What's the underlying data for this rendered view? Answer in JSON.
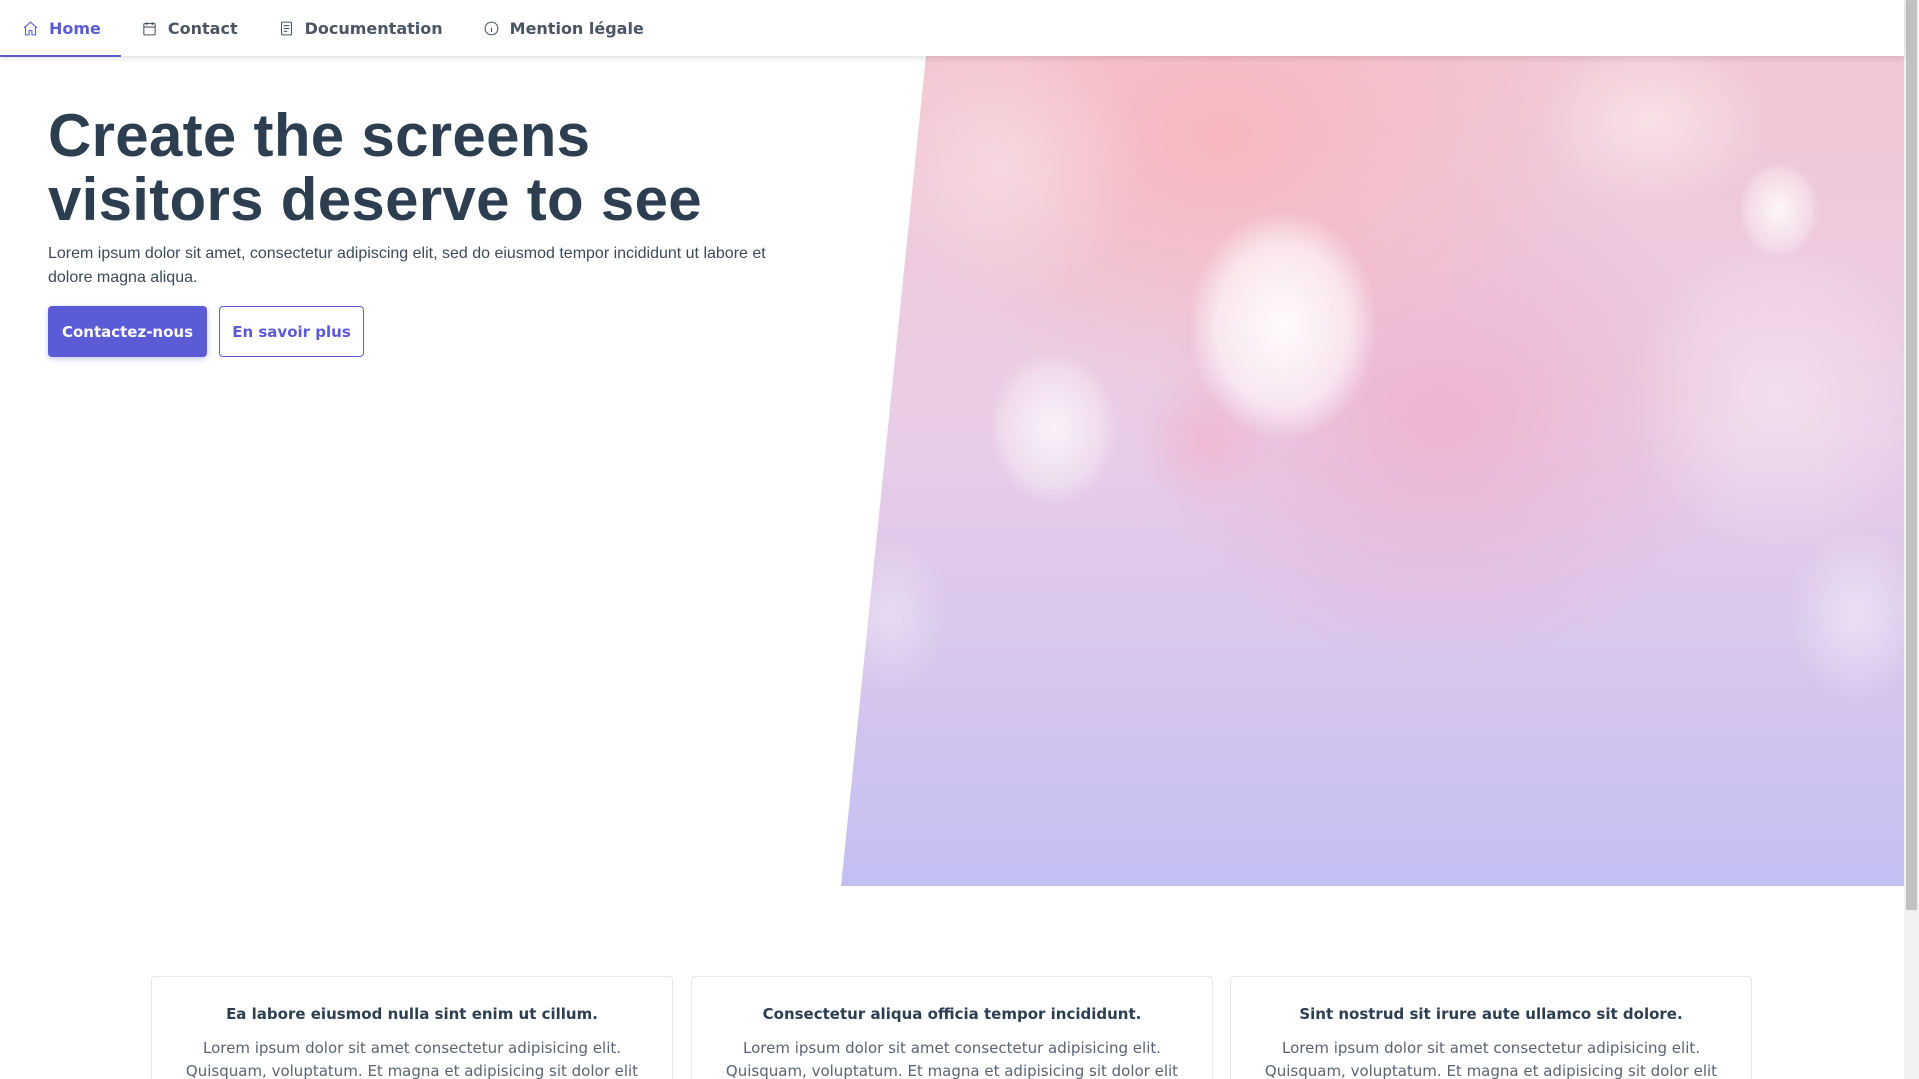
{
  "nav": {
    "items": [
      {
        "label": "Home",
        "icon": "home-icon",
        "active": true
      },
      {
        "label": "Contact",
        "icon": "calendar-icon",
        "active": false
      },
      {
        "label": "Documentation",
        "icon": "document-icon",
        "active": false
      },
      {
        "label": "Mention légale",
        "icon": "info-icon",
        "active": false
      }
    ]
  },
  "hero": {
    "title": "Create the screens visitors deserve to see",
    "text": "Lorem ipsum dolor sit amet, consectetur adipiscing elit, sed do eiusmod tempor incididunt ut labore et dolore magna aliqua.",
    "primary_button": "Contactez-nous",
    "secondary_button": "En savoir plus"
  },
  "cards": [
    {
      "title": "Ea labore eiusmod nulla sint enim ut cillum.",
      "text": "Lorem ipsum dolor sit amet consectetur adipisicing elit. Quisquam, voluptatum. Et magna et adipisicing sit dolor elit eiusmod pariatur"
    },
    {
      "title": "Consectetur aliqua officia tempor incididunt.",
      "text": "Lorem ipsum dolor sit amet consectetur adipisicing elit. Quisquam, voluptatum. Et magna et adipisicing sit dolor elit eiusmod pariatur"
    },
    {
      "title": "Sint nostrud sit irure aute ullamco sit dolore.",
      "text": "Lorem ipsum dolor sit amet consectetur adipisicing elit. Quisquam, voluptatum. Et magna et adipisicing sit dolor elit eiusmod pariatur"
    }
  ],
  "colors": {
    "accent": "#5b5bd6",
    "heading": "#2d3e50"
  }
}
